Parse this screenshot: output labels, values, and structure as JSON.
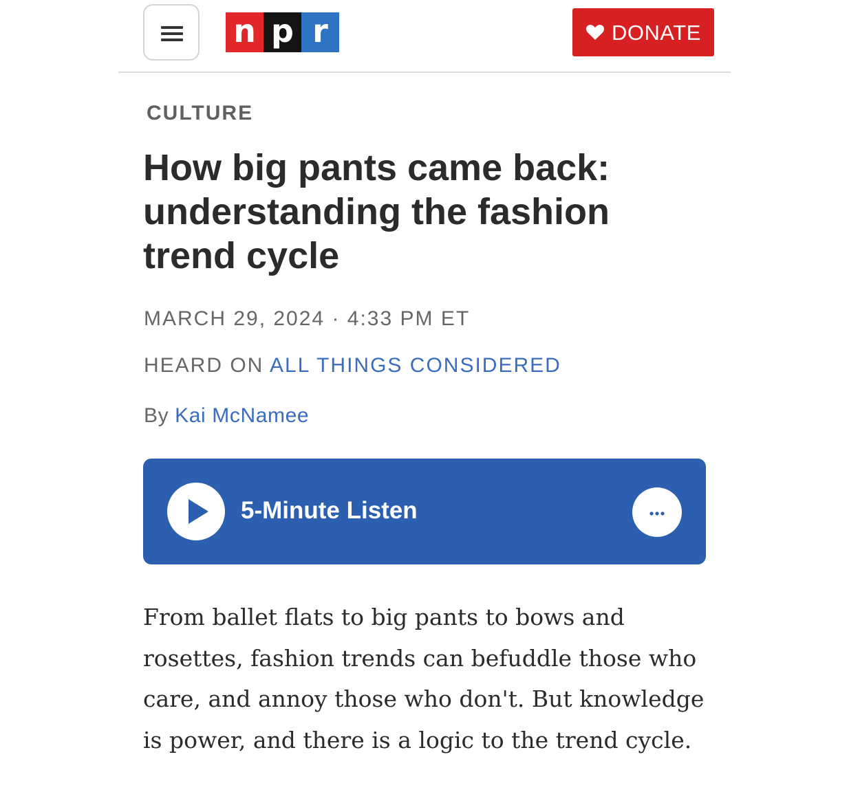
{
  "header": {
    "menu_icon": "hamburger-menu-icon",
    "logo": {
      "letters": [
        "n",
        "p",
        "r"
      ],
      "colors": [
        "#e3262a",
        "#141414",
        "#2f74c4"
      ]
    },
    "donate": {
      "icon": "heart-icon",
      "label": "DONATE",
      "color": "#d62021"
    }
  },
  "article": {
    "section": "CULTURE",
    "headline": "How big pants came back: understanding the fashion trend cycle",
    "dateline": "MARCH 29, 2024 · 4:33 PM ET",
    "heard_on": {
      "prefix": "HEARD ON",
      "show": "ALL THINGS CONSIDERED"
    },
    "byline": {
      "prefix": "By",
      "author": "Kai McNamee"
    },
    "link_color": "#3a6cc0"
  },
  "player": {
    "play_icon": "play-icon",
    "title": "5-Minute Listen",
    "more_icon": "more-options-icon",
    "background": "#2c5faf"
  },
  "body": {
    "paragraph": "From ballet flats to big pants to bows and rosettes, fashion trends can befuddle those who care, and annoy those who don't. But knowledge is power, and there is a logic to the trend cycle."
  }
}
